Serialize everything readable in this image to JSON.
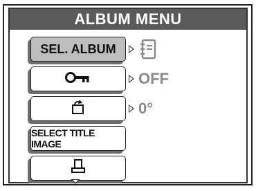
{
  "menu": {
    "title": "ALBUM MENU",
    "items": [
      {
        "label": "SEL. ALBUM",
        "icon": "",
        "value": "",
        "value_icon": "album-book-icon",
        "selected": true
      },
      {
        "label": "",
        "icon": "key-icon",
        "value": "OFF",
        "selected": false
      },
      {
        "label": "",
        "icon": "rotate-icon",
        "value": "0°",
        "selected": false
      },
      {
        "label": "SELECT TITLE IMAGE",
        "icon": "",
        "value": "",
        "selected": false
      },
      {
        "label": "",
        "icon": "print-icon",
        "value": "",
        "selected": false
      }
    ],
    "scroll_indicator": "more-below-arrow-icon"
  },
  "colors": {
    "title_bg": "#5a5a5a",
    "selected_bg": "#bdbdbd",
    "value_text": "#8a8a8a"
  }
}
